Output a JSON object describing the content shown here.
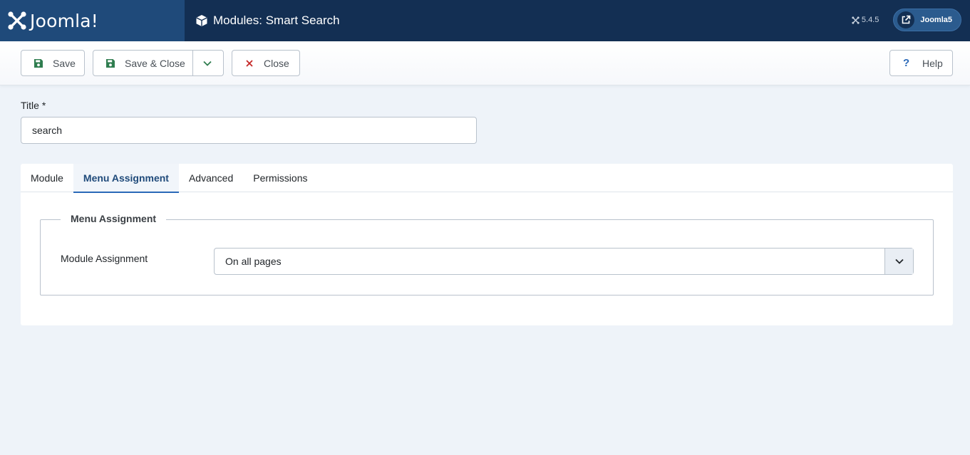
{
  "header": {
    "brand": "Joomla!",
    "page_title": "Modules: Smart Search",
    "version": "5.4.5",
    "user": "Joomla5"
  },
  "toolbar": {
    "save_label": "Save",
    "save_close_label": "Save & Close",
    "close_label": "Close",
    "help_label": "Help"
  },
  "form": {
    "title_label": "Title *",
    "title_value": "search"
  },
  "tabs": [
    {
      "label": "Module",
      "active": false
    },
    {
      "label": "Menu Assignment",
      "active": true
    },
    {
      "label": "Advanced",
      "active": false
    },
    {
      "label": "Permissions",
      "active": false
    }
  ],
  "menu_assignment": {
    "legend": "Menu Assignment",
    "field_label": "Module Assignment",
    "selected": "On all pages"
  },
  "colors": {
    "header_bg": "#132f53",
    "brand_bg": "#1f4a7a",
    "save_icon": "#2f7d4f",
    "close_icon": "#c52827",
    "help_icon": "#2a69b8",
    "page_bg": "#eef3f9"
  }
}
